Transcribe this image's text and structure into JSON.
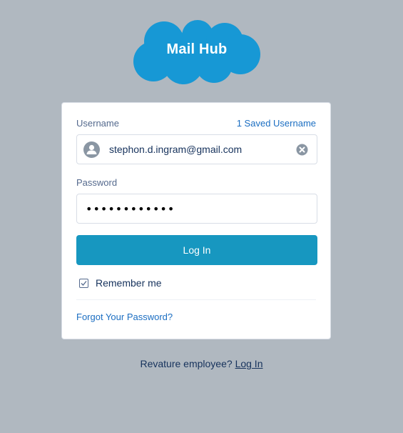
{
  "logo": {
    "text": "Mail Hub"
  },
  "form": {
    "username_label": "Username",
    "saved_username_link": "1 Saved Username",
    "username_value": "stephon.d.ingram@gmail.com",
    "password_label": "Password",
    "password_value": "••••••••••••",
    "login_button": "Log In",
    "remember_label": "Remember me",
    "remember_checked": true,
    "forgot_link": "Forgot Your Password?"
  },
  "footer": {
    "prompt": "Revature employee?",
    "link": "Log In"
  },
  "colors": {
    "background": "#b0b8c0",
    "brand": "#1797c0",
    "link": "#1b6ec2"
  },
  "icons": [
    "cloud-logo-icon",
    "user-avatar-icon",
    "clear-icon",
    "checkmark-icon"
  ]
}
